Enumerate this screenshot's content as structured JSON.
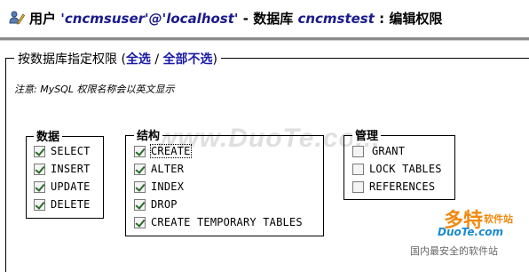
{
  "header": {
    "prefix": "用户",
    "user": "'cncmsuser'@'localhost'",
    "sep1": "- 数据库",
    "database": "cncmstest",
    "sep2": ": 编辑权限"
  },
  "fieldset": {
    "legend": "按数据库指定权限",
    "open_paren": "(",
    "select_all": "全选",
    "slash": "/",
    "select_none": "全部不选",
    "close_paren": ")"
  },
  "note": "注意: MySQL 权限名称会以英文显示",
  "groups": {
    "data": {
      "legend": "数据",
      "items": [
        {
          "label": "SELECT",
          "checked": true
        },
        {
          "label": "INSERT",
          "checked": true
        },
        {
          "label": "UPDATE",
          "checked": true
        },
        {
          "label": "DELETE",
          "checked": true
        }
      ]
    },
    "structure": {
      "legend": "结构",
      "items": [
        {
          "label": "CREATE",
          "checked": true
        },
        {
          "label": "ALTER",
          "checked": true
        },
        {
          "label": "INDEX",
          "checked": true
        },
        {
          "label": "DROP",
          "checked": true
        },
        {
          "label": "CREATE TEMPORARY TABLES",
          "checked": true
        }
      ]
    },
    "admin": {
      "legend": "管理",
      "items": [
        {
          "label": "GRANT",
          "checked": false
        },
        {
          "label": "LOCK TABLES",
          "checked": false
        },
        {
          "label": "REFERENCES",
          "checked": false
        }
      ]
    }
  },
  "watermark": "www.DuoTe.com",
  "logo": {
    "main": "多特",
    "sub": "软件站",
    "url": "DuoTe.com",
    "slogan": "国内最安全的软件站"
  },
  "colors": {
    "link": "#1a1aa6",
    "user_text": "#1a1a8c",
    "logo_orange": "#f08a10",
    "logo_blue": "#1a8ad0"
  },
  "icons": {
    "title": "user-edit-icon"
  }
}
